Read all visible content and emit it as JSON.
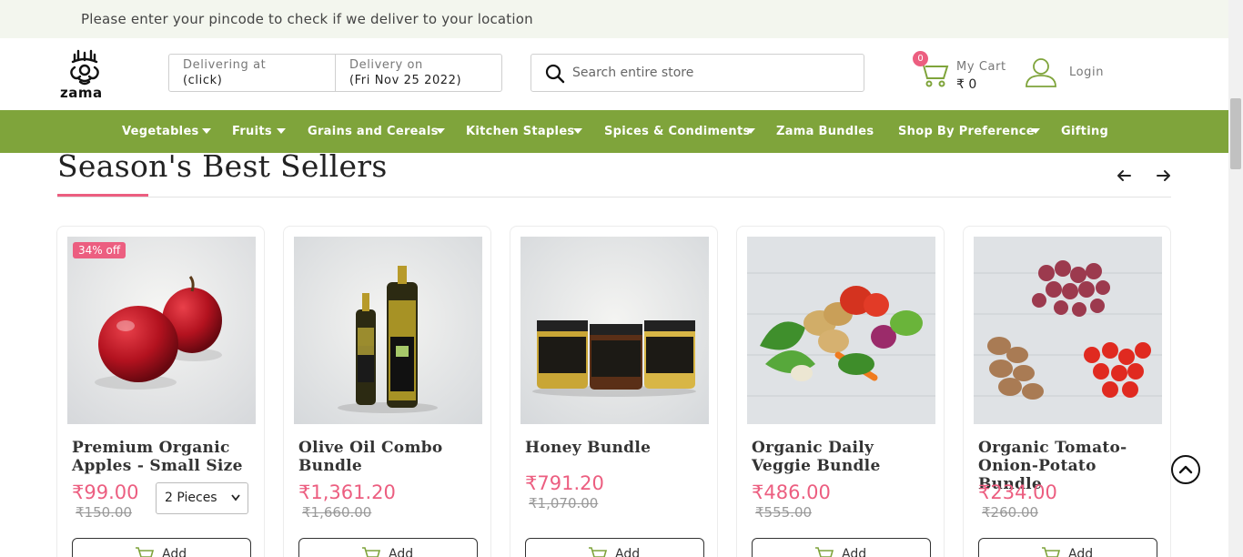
{
  "topbar": {
    "message": "Please enter your pincode to check if we deliver to your location"
  },
  "header": {
    "logo_text": "zama",
    "delivering_at_label": "Delivering at",
    "delivering_at_value": "(click)",
    "delivery_on_label": "Delivery on",
    "delivery_on_value": "(Fri Nov 25 2022)",
    "search_placeholder": "Search entire store",
    "cart_count": "0",
    "cart_label": "My Cart",
    "cart_total": "₹ 0",
    "login_label": "Login"
  },
  "nav": {
    "items": [
      {
        "label": "Vegetables",
        "dropdown": true
      },
      {
        "label": "Fruits",
        "dropdown": true
      },
      {
        "label": "Grains and Cereals",
        "dropdown": true
      },
      {
        "label": "Kitchen Staples",
        "dropdown": true
      },
      {
        "label": "Spices & Condiments",
        "dropdown": true
      },
      {
        "label": "Zama Bundles",
        "dropdown": false
      },
      {
        "label": "Shop By Preference",
        "dropdown": true
      },
      {
        "label": "Gifting",
        "dropdown": false
      }
    ]
  },
  "section": {
    "title": "Season's Best Sellers"
  },
  "products": [
    {
      "name": "Premium Organic Apples - Small Size",
      "price": "₹99.00",
      "mrp": "₹150.00",
      "badge": "34% off",
      "variant": "2 Pieces",
      "add_label": "Add"
    },
    {
      "name": "Olive Oil Combo Bundle",
      "price": "₹1,361.20",
      "mrp": "₹1,660.00",
      "add_label": "Add"
    },
    {
      "name": "Honey Bundle",
      "price": "₹791.20",
      "mrp": "₹1,070.00",
      "add_label": "Add"
    },
    {
      "name": "Organic Daily Veggie Bundle",
      "price": "₹486.00",
      "mrp": "₹555.00",
      "add_label": "Add"
    },
    {
      "name": "Organic Tomato-Onion-Potato Bundle",
      "price": "₹234.00",
      "mrp": "₹260.00",
      "add_label": "Add"
    }
  ],
  "colors": {
    "brand_green": "#7fa43b",
    "accent_pink": "#ec5e80",
    "topbar_bg": "#f3f6ee"
  }
}
